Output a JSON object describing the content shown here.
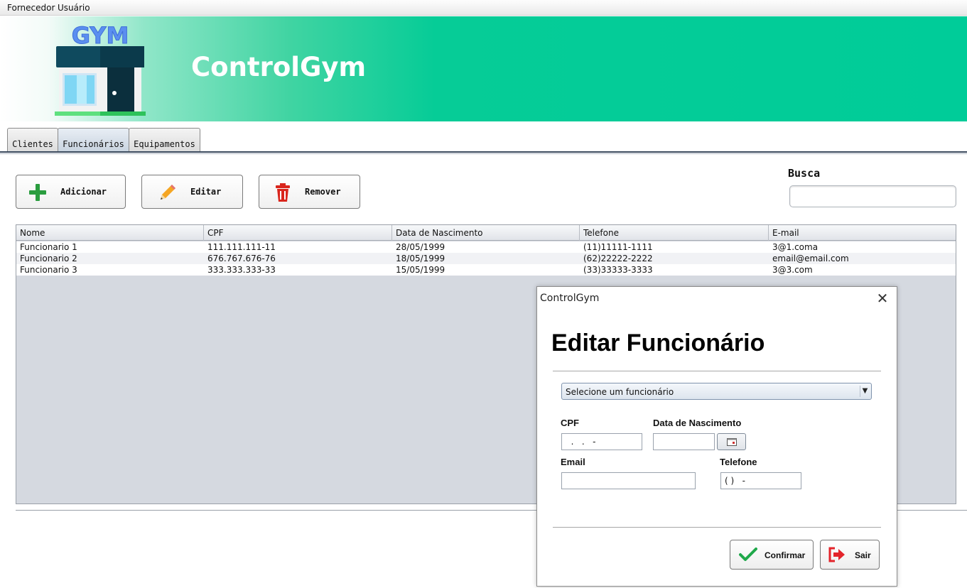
{
  "menubar": {
    "items": [
      "Fornecedor",
      "Usuário"
    ]
  },
  "banner": {
    "logo_text": "GYM",
    "title": "ControlGym"
  },
  "tabs": [
    "Clientes",
    "Funcionários",
    "Equipamentos"
  ],
  "active_tab": "Funcionários",
  "toolbar": {
    "add_label": "Adicionar",
    "edit_label": "Editar",
    "remove_label": "Remover"
  },
  "search": {
    "label": "Busca",
    "value": ""
  },
  "table": {
    "columns": [
      "Nome",
      "CPF",
      "Data de Nascimento",
      "Telefone",
      "E-mail"
    ],
    "rows": [
      [
        "Funcionario 1",
        "111.111.111-11",
        "28/05/1999",
        "(11)11111-1111",
        "3@1.coma"
      ],
      [
        "Funcionario 2",
        "676.767.676-76",
        "18/05/1999",
        "(62)22222-2222",
        "email@email.com"
      ],
      [
        "Funcionario 3",
        "333.333.333-33",
        "15/05/1999",
        "(33)33333-3333",
        "3@3.com"
      ]
    ]
  },
  "dialog": {
    "window_title": "ControlGym",
    "close_glyph": "✕",
    "heading": "Editar Funcionário",
    "select": {
      "value": "Selecione um funcionário"
    },
    "cpf": {
      "label": "CPF",
      "value": "  .   .   -"
    },
    "birth": {
      "label": "Data de Nascimento",
      "value": ""
    },
    "email": {
      "label": "Email",
      "value": ""
    },
    "phone": {
      "label": "Telefone",
      "value": "( )   -"
    },
    "confirm_label": "Confirmar",
    "exit_label": "Sair"
  },
  "colors": {
    "banner": "#00cc99",
    "add_icon": "#2a9d3f",
    "remove_icon": "#d9251c",
    "confirm_icon": "#1fa84a",
    "exit_icon": "#e3242b"
  }
}
